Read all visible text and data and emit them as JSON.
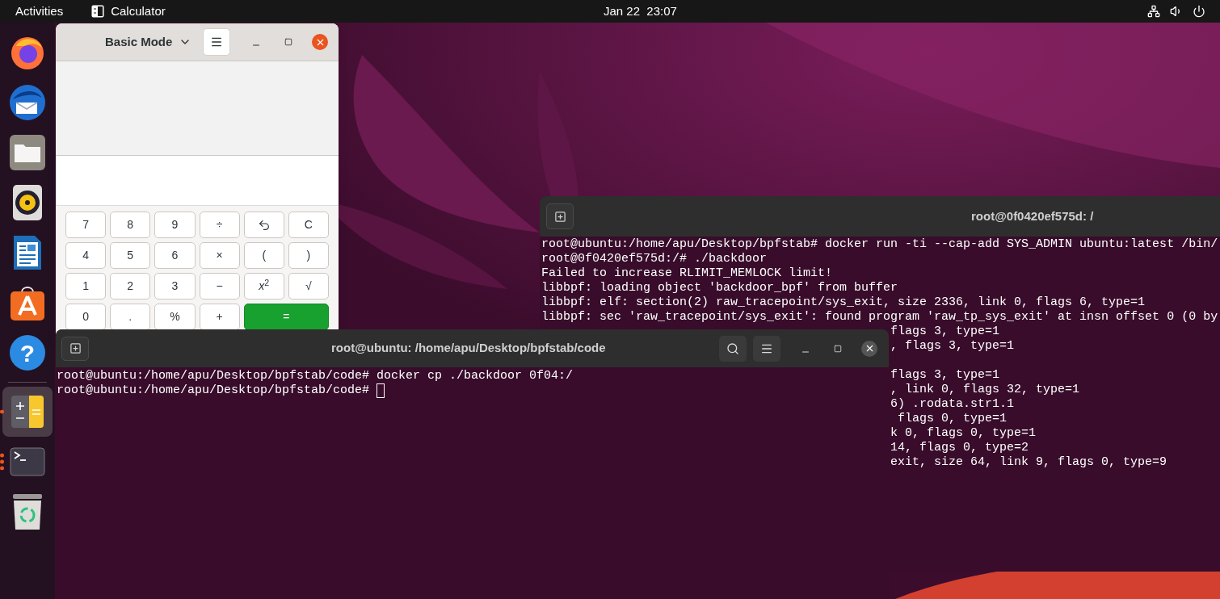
{
  "top_bar": {
    "activities": "Activities",
    "app_menu": "Calculator",
    "clock": "Jan 22  23:07"
  },
  "dock": {
    "items": [
      {
        "kind": "firefox",
        "selected": false,
        "running": false
      },
      {
        "kind": "thunderbird",
        "selected": false,
        "running": false
      },
      {
        "kind": "files",
        "selected": false,
        "running": false
      },
      {
        "kind": "rhythmbox",
        "selected": false,
        "running": false
      },
      {
        "kind": "writer",
        "selected": false,
        "running": false
      },
      {
        "kind": "software",
        "selected": false,
        "running": false
      },
      {
        "kind": "help",
        "glyph": "?",
        "selected": false,
        "running": false
      },
      {
        "kind": "separator"
      },
      {
        "kind": "calculator",
        "selected": true,
        "running": true,
        "multiple_windows": false
      },
      {
        "kind": "terminal",
        "selected": false,
        "running": true,
        "multiple_windows": true
      },
      {
        "kind": "trash",
        "selected": false,
        "running": false
      }
    ]
  },
  "calculator": {
    "mode": "Basic Mode",
    "keys": [
      {
        "kind": "key",
        "label": "7"
      },
      {
        "kind": "key",
        "label": "8"
      },
      {
        "kind": "key",
        "label": "9"
      },
      {
        "kind": "key",
        "label": "÷"
      },
      {
        "kind": "undo"
      },
      {
        "kind": "key",
        "label": "C"
      },
      {
        "kind": "key",
        "label": "4"
      },
      {
        "kind": "key",
        "label": "5"
      },
      {
        "kind": "key",
        "label": "6"
      },
      {
        "kind": "key",
        "label": "×"
      },
      {
        "kind": "key",
        "label": "("
      },
      {
        "kind": "key",
        "label": ")"
      },
      {
        "kind": "key",
        "label": "1"
      },
      {
        "kind": "key",
        "label": "2"
      },
      {
        "kind": "key",
        "label": "3"
      },
      {
        "kind": "key",
        "label": "−"
      },
      {
        "kind": "key",
        "label": "*x*$^{2}$"
      },
      {
        "kind": "key",
        "label": "√"
      },
      {
        "kind": "key",
        "label": "0"
      },
      {
        "kind": "key",
        "label": "."
      },
      {
        "kind": "key",
        "label": "%"
      },
      {
        "kind": "key",
        "label": "+"
      },
      {
        "kind": "equals",
        "label": "="
      }
    ]
  },
  "back_terminal": {
    "title": "root@0f0420ef575d: /",
    "lines": [
      "root@ubuntu:/home/apu/Desktop/bpfstab# docker run -ti --cap-add SYS_ADMIN ubuntu:latest /bin/",
      "root@0f0420ef575d:/# ./backdoor",
      "Failed to increase RLIMIT_MEMLOCK limit!",
      "libbpf: loading object 'backdoor_bpf' from buffer",
      "libbpf: elf: section(2) raw_tracepoint/sys_exit, size 2336, link 0, flags 6, type=1",
      "libbpf: sec 'raw_tracepoint/sys_exit': found program 'raw_tp_sys_exit' at insn offset 0 (0 by"
    ],
    "partly_covered_blocks": [
      [
        "flags 3, type=1",
        ", flags 3, type=1"
      ],
      [
        "flags 3, type=1",
        ", link 0, flags 32, type=1",
        "6) .rodata.str1.1",
        " flags 0, type=1",
        "k 0, flags 0, type=1",
        "14, flags 0, type=2",
        "exit, size 64, link 9, flags 0, type=9"
      ]
    ]
  },
  "front_terminal": {
    "title": "root@ubuntu: /home/apu/Desktop/bpfstab/code",
    "lines": [
      "root@ubuntu:/home/apu/Desktop/bpfstab/code# docker cp ./backdoor 0f04:/",
      "root@ubuntu:/home/apu/Desktop/bpfstab/code# "
    ],
    "cursor": true
  }
}
